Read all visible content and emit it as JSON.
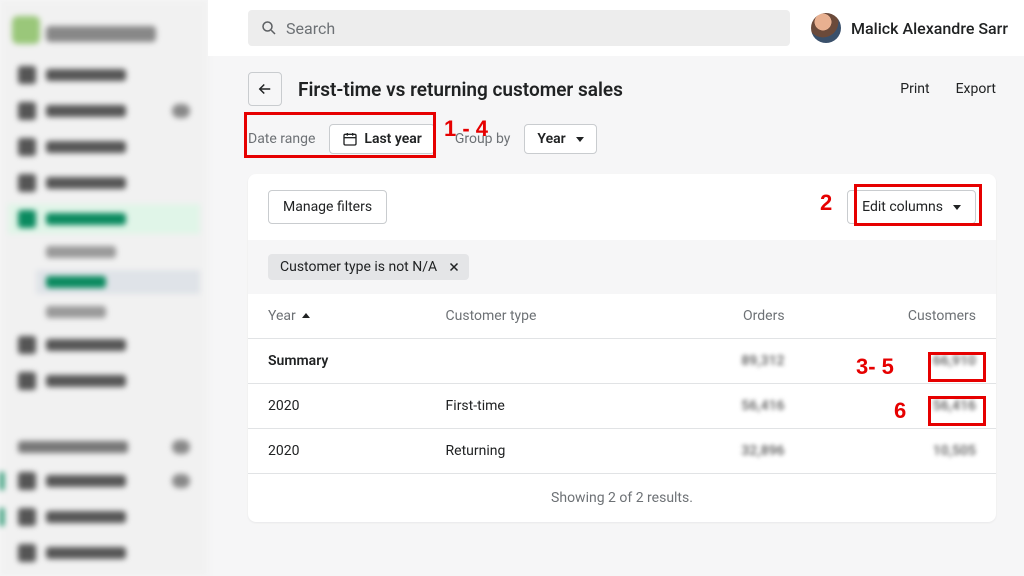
{
  "top": {
    "search_placeholder": "Search",
    "user_name": "Malick Alexandre Sarr"
  },
  "header": {
    "title": "First-time vs returning customer sales",
    "print": "Print",
    "export": "Export"
  },
  "controls": {
    "date_range_label": "Date range",
    "date_range_value": "Last year",
    "group_by_label": "Group by",
    "group_by_value": "Year"
  },
  "card": {
    "manage_filters": "Manage filters",
    "edit_columns": "Edit columns",
    "filter_chip": "Customer type is not N/A"
  },
  "table": {
    "columns": {
      "year": "Year",
      "customer_type": "Customer type",
      "orders": "Orders",
      "customers": "Customers"
    },
    "summary": {
      "label": "Summary",
      "orders": "89,312",
      "customers": "66,910"
    },
    "rows": [
      {
        "year": "2020",
        "customer_type": "First-time",
        "orders": "56,416",
        "customers": "56,416"
      },
      {
        "year": "2020",
        "customer_type": "Returning",
        "orders": "32,896",
        "customers": "10,505"
      }
    ],
    "footer": "Showing 2 of 2 results."
  },
  "annotations": {
    "a1": "1 - 4",
    "a2": "2",
    "a3": "3- 5",
    "a4": "6"
  }
}
